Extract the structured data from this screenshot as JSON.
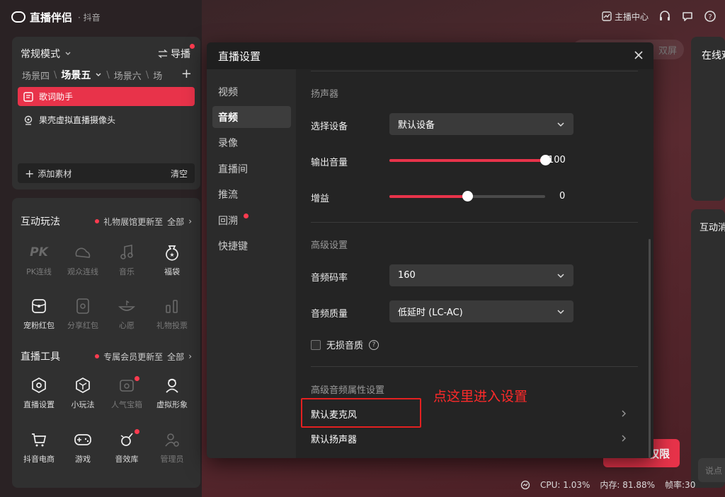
{
  "app": {
    "title": "直播伴侣",
    "subtitle": "· 抖音"
  },
  "topbar": {
    "anchor_center": "主播中心"
  },
  "scene_panel": {
    "mode": "常规模式",
    "guide": "导播",
    "tabs": [
      "场景四",
      "场景五",
      "场景六",
      "场"
    ],
    "sources": [
      {
        "label": "歌词助手",
        "icon": "lyrics-icon"
      },
      {
        "label": "果壳虚拟直播摄像头",
        "icon": "camera-icon"
      }
    ],
    "add_label": "添加素材",
    "clear_label": "清空"
  },
  "interactive": {
    "title": "互动玩法",
    "notice": "礼物展馆更新至",
    "all": "全部",
    "items": [
      {
        "label": "PK连线",
        "icon": "pk-icon"
      },
      {
        "label": "观众连线",
        "icon": "audience-link-icon"
      },
      {
        "label": "音乐",
        "icon": "music-icon"
      },
      {
        "label": "福袋",
        "icon": "lucky-bag-icon"
      },
      {
        "label": "宠粉红包",
        "icon": "red-packet-icon"
      },
      {
        "label": "分享红包",
        "icon": "share-packet-icon"
      },
      {
        "label": "心愿",
        "icon": "wish-icon"
      },
      {
        "label": "礼物投票",
        "icon": "gift-vote-icon"
      }
    ]
  },
  "tools": {
    "title": "直播工具",
    "notice": "专属会员更新至",
    "all": "全部",
    "items": [
      {
        "label": "直播设置",
        "icon": "live-settings-icon"
      },
      {
        "label": "小玩法",
        "icon": "mini-game-icon"
      },
      {
        "label": "人气宝箱",
        "icon": "treasure-box-icon"
      },
      {
        "label": "虚拟形象",
        "icon": "avatar-icon"
      },
      {
        "label": "抖音电商",
        "icon": "cart-icon"
      },
      {
        "label": "游戏",
        "icon": "gamepad-icon"
      },
      {
        "label": "音效库",
        "icon": "sound-effects-icon"
      },
      {
        "label": "管理员",
        "icon": "admin-icon"
      }
    ]
  },
  "dialog": {
    "title": "直播设置",
    "nav": [
      "视频",
      "音频",
      "录像",
      "直播间",
      "推流",
      "回溯",
      "快捷键"
    ],
    "speaker_group": "扬声器",
    "select_device_label": "选择设备",
    "select_device_value": "默认设备",
    "output_volume_label": "输出音量",
    "output_volume_value": "100",
    "output_volume": 1.0,
    "gain_label": "增益",
    "gain_value": "0",
    "gain": 0.5,
    "advanced_group": "高级设置",
    "bitrate_label": "音频码率",
    "bitrate_value": "160",
    "quality_label": "音频质量",
    "quality_value": "低延时 (LC-AC)",
    "lossless_label": "无损音质",
    "adv_audio_group": "高级音频属性设置",
    "default_mic": "默认麦克风",
    "default_speaker": "默认扬声器"
  },
  "annotation": "点这里进入设置",
  "right": {
    "online_label": "在线观",
    "interact_label": "互动消",
    "dual_screen": "双屏",
    "permission_btn": "权限",
    "chat_placeholder": "说点"
  },
  "status": {
    "cpu": "CPU: 1.03%",
    "memory": "内存: 81.88%",
    "fps": "帧率:30"
  },
  "colors": {
    "accent": "#e8334a",
    "annotation": "#ff2a2a"
  }
}
